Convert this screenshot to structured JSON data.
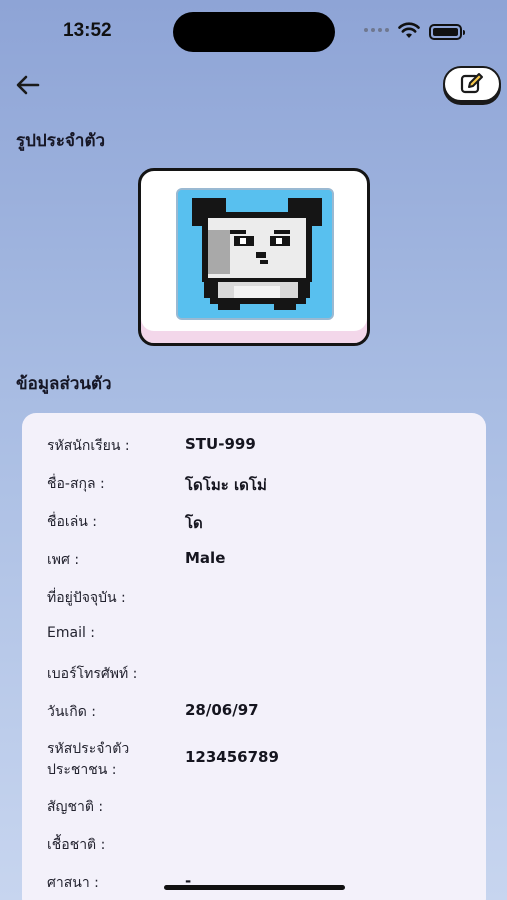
{
  "status_bar": {
    "time": "13:52"
  },
  "header": {
    "back_icon": "arrow-left-icon",
    "edit_icon": "edit-icon"
  },
  "profile_picture": {
    "section_title": "รูปประจำตัว",
    "avatar_icon": "pixel-panda-avatar"
  },
  "personal_info": {
    "section_title": "ข้อมูลส่วนตัว",
    "fields": [
      {
        "label": "รหัสนักเรียน :",
        "value": "STU-999"
      },
      {
        "label": "ชื่อ-สกุล :",
        "value": "โดโมะ เดโม่"
      },
      {
        "label": "ชื่อเล่น :",
        "value": "โด"
      },
      {
        "label": "เพศ :",
        "value": "Male"
      },
      {
        "label": "ที่อยู่ปัจจุบัน :",
        "value": ""
      },
      {
        "label": "Email :",
        "value": ""
      },
      {
        "label": "เบอร์โทรศัพท์ :",
        "value": ""
      },
      {
        "label": "วันเกิด :",
        "value": "28/06/97"
      },
      {
        "label_line1": "รหัสประจำตัว",
        "label_line2": "ประชาชน :",
        "value": "123456789"
      },
      {
        "label": "สัญชาติ :",
        "value": ""
      },
      {
        "label": "เชื้อชาติ :",
        "value": ""
      },
      {
        "label": "ศาสนา :",
        "value": "-"
      }
    ]
  }
}
